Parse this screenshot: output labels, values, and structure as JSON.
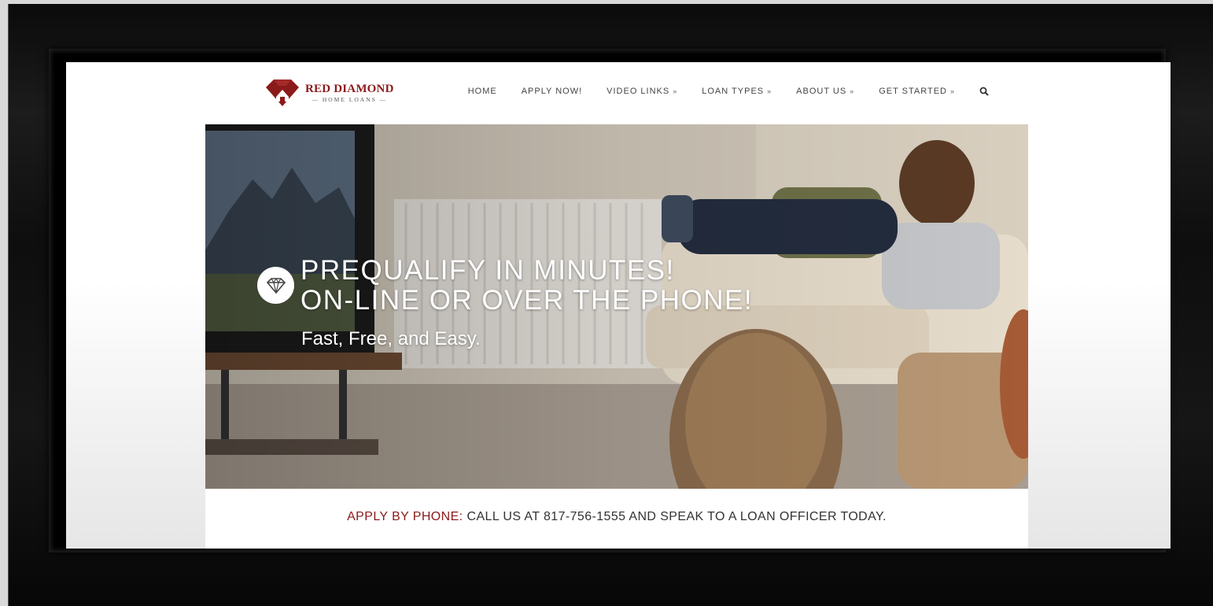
{
  "brand": {
    "name": "RED DIAMOND",
    "tagline": "HOME LOANS",
    "primary_color": "#8b1a1a"
  },
  "nav": {
    "items": [
      {
        "label": "HOME",
        "has_dropdown": false
      },
      {
        "label": "APPLY NOW!",
        "has_dropdown": false
      },
      {
        "label": "VIDEO LINKS",
        "has_dropdown": true
      },
      {
        "label": "LOAN TYPES",
        "has_dropdown": true
      },
      {
        "label": "ABOUT US",
        "has_dropdown": true
      },
      {
        "label": "GET STARTED",
        "has_dropdown": true
      }
    ],
    "dropdown_glyph": "»",
    "search_icon": "search-icon"
  },
  "hero": {
    "title_line1": "PREQUALIFY IN MINUTES!",
    "title_line2": "ON-LINE OR OVER THE PHONE!",
    "subtitle": "Fast, Free, and Easy.",
    "badge_icon": "diamond-icon"
  },
  "callbar": {
    "label": "APPLY BY PHONE:",
    "text": "CALL US AT 817-756-1555 AND SPEAK TO A LOAN OFFICER TODAY."
  }
}
